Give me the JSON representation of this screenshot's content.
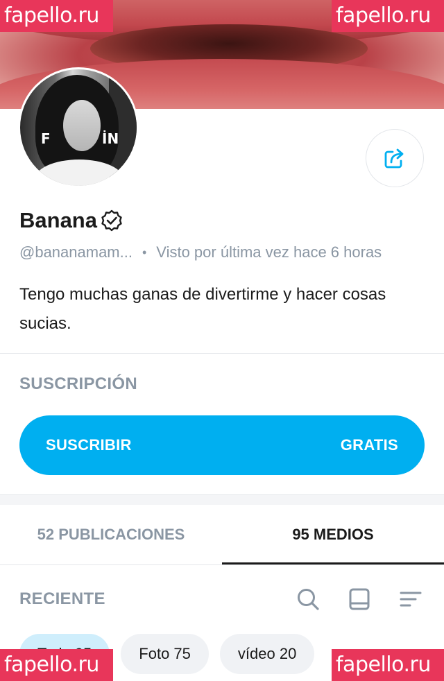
{
  "watermarks": {
    "text": "fapello.ru"
  },
  "profile": {
    "name": "Banana",
    "username": "@bananamam...",
    "last_seen": "Visto por última vez hace 6 horas",
    "separator": "•",
    "bio": "Tengo muchas ganas de divertirme y hacer cosas sucias.",
    "avatar_letters": [
      "F",
      "İN"
    ]
  },
  "subscription": {
    "section_label": "SUSCRIPCIÓN",
    "button_label": "SUSCRIBIR",
    "price_label": "GRATIS"
  },
  "tabs": [
    {
      "label": "52 PUBLICACIONES",
      "active": false
    },
    {
      "label": "95 MEDIOS",
      "active": true
    }
  ],
  "media": {
    "sort_label": "RECIENTE",
    "filters": [
      {
        "label": "Todo 95",
        "active": true
      },
      {
        "label": "Foto 75",
        "active": false
      },
      {
        "label": "vídeo 20",
        "active": false
      }
    ]
  },
  "colors": {
    "accent": "#00aff0",
    "muted_text": "#8a96a3",
    "watermark": "#e8365a",
    "active_chip": "#cfeefc"
  },
  "icons": [
    "share-icon",
    "verified-icon",
    "search-icon",
    "layout-icon",
    "sort-icon"
  ]
}
